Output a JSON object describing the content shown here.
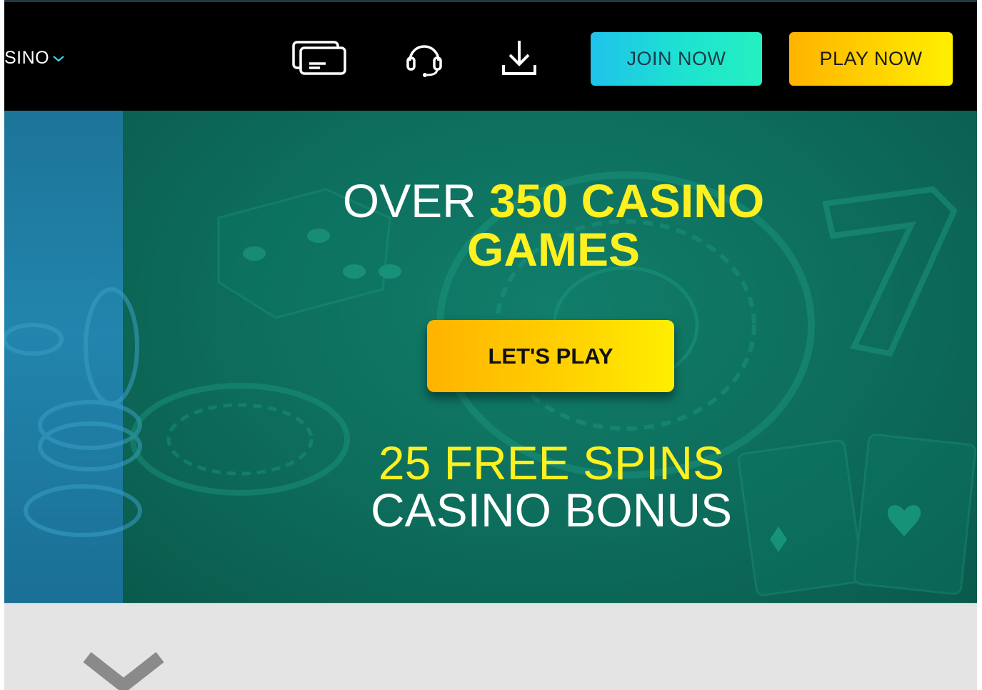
{
  "header": {
    "brand": "SINO",
    "icons": [
      "cards-icon",
      "headset-icon",
      "download-icon"
    ],
    "join_label": "JOIN NOW",
    "play_label": "PLAY NOW"
  },
  "hero": {
    "headline_white": "OVER ",
    "headline_yellow_1": "350 CASINO",
    "headline_yellow_2": "GAMES",
    "cta_label": "LET'S PLAY",
    "bonus_line1": "25 FREE SPINS",
    "bonus_line2": "CASINO BONUS"
  },
  "colors": {
    "header_bg": "#000000",
    "hero_green": "#0d6c5b",
    "hero_blue": "#2285ad",
    "accent_yellow": "#fff01f",
    "join_gradient": [
      "#1fc3ea",
      "#24f0c2"
    ],
    "play_gradient": [
      "#ffb300",
      "#fff000"
    ],
    "bottom_bg": "#e4e4e4"
  },
  "bottom": {
    "icon": "chevron-down-icon"
  }
}
